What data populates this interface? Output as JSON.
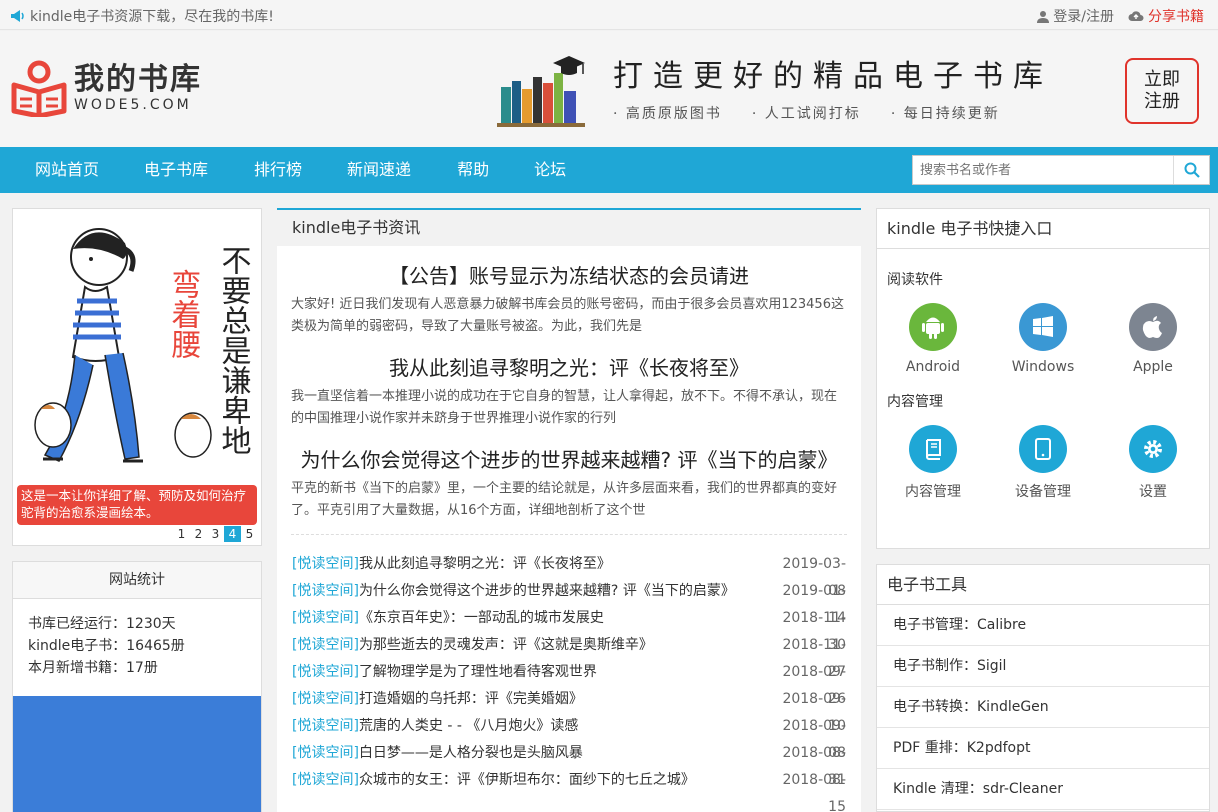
{
  "topbar": {
    "tagline": "kindle电子书资源下载，尽在我的书库!",
    "login": "登录/注册",
    "share": "分享书籍"
  },
  "header": {
    "logo_title": "我的书库",
    "logo_sub": "WODE5.COM",
    "slogan_title": "打造更好的精品电子书库",
    "slogan_items": [
      "· 高质原版图书",
      "· 人工试阅打标",
      "· 每日持续更新"
    ],
    "register_line1": "立即",
    "register_line2": "注册"
  },
  "nav": {
    "items": [
      "网站首页",
      "电子书库",
      "排行榜",
      "新闻速递",
      "帮助",
      "论坛"
    ],
    "search_placeholder": "搜索书名或作者"
  },
  "banner": {
    "title_red": "弯着腰",
    "title_black": "不要总是谦卑地",
    "caption": "这是一本让你详细了解、预防及如何治疗驼背的治愈系漫画绘本。",
    "dots": [
      "1",
      "2",
      "3",
      "4",
      "5"
    ],
    "active_dot": 4
  },
  "stats": {
    "title": "网站统计",
    "lines": [
      "书库已经运行：1230天",
      "kindle电子书：16465册",
      "本月新增书籍：17册"
    ]
  },
  "news": {
    "header": "kindle电子书资讯",
    "articles": [
      {
        "title": "【公告】账号显示为冻结状态的会员请进",
        "summary": "大家好! 近日我们发现有人恶意暴力破解书库会员的账号密码，而由于很多会员喜欢用123456这类极为简单的弱密码，导致了大量账号被盗。为此，我们先是"
      },
      {
        "title": "我从此刻追寻黎明之光：评《长夜将至》",
        "summary": "我一直坚信着一本推理小说的成功在于它自身的智慧，让人拿得起，放不下。不得不承认，现在的中国推理小说作家并未跻身于世界推理小说作家的行列"
      },
      {
        "title": "为什么你会觉得这个进步的世界越来越糟? 评《当下的启蒙》",
        "summary": "平克的新书《当下的启蒙》里，一个主要的结论就是，从许多层面来看，我们的世界都真的变好了。平克引用了大量数据，从16个方面，详细地剖析了这个世"
      }
    ],
    "list": [
      {
        "cat": "[悦读空间]",
        "title": "我从此刻追寻黎明之光：评《长夜将至》",
        "date": "2019-03-08"
      },
      {
        "cat": "[悦读空间]",
        "title": "为什么你会觉得这个进步的世界越来越糟? 评《当下的启蒙》",
        "date": "2019-01-14"
      },
      {
        "cat": "[悦读空间]",
        "title": "《东京百年史》：一部动乱的城市发展史",
        "date": "2018-11-30"
      },
      {
        "cat": "[悦读空间]",
        "title": "为那些逝去的灵魂发声：评《这就是奥斯维辛》",
        "date": "2018-11-27"
      },
      {
        "cat": "[悦读空间]",
        "title": "了解物理学是为了理性地看待客观世界",
        "date": "2018-09-26"
      },
      {
        "cat": "[悦读空间]",
        "title": "打造婚姻的乌托邦：评《完美婚姻》",
        "date": "2018-09-10"
      },
      {
        "cat": "[悦读空间]",
        "title": "荒唐的人类史 - - 《八月炮火》读感",
        "date": "2018-09-08"
      },
      {
        "cat": "[悦读空间]",
        "title": "白日梦——是人格分裂也是头脑风暴",
        "date": "2018-08-31"
      },
      {
        "cat": "[悦读空间]",
        "title": "众城市的女王：评《伊斯坦布尔：面纱下的七丘之城》",
        "date": "2018-08-15"
      }
    ]
  },
  "quick": {
    "title": "kindle 电子书快捷入口",
    "reading_label": "阅读软件",
    "reading": [
      {
        "label": "Android",
        "icon": "android-icon",
        "color": "#6ab73c"
      },
      {
        "label": "Windows",
        "icon": "windows-icon",
        "color": "#3a98d4"
      },
      {
        "label": "Apple",
        "icon": "apple-icon",
        "color": "#7d8591"
      }
    ],
    "manage_label": "内容管理",
    "manage": [
      {
        "label": "内容管理",
        "icon": "book-icon",
        "color": "#1fa7d6"
      },
      {
        "label": "设备管理",
        "icon": "tablet-icon",
        "color": "#1fa7d6"
      },
      {
        "label": "设置",
        "icon": "gear-icon",
        "color": "#1fa7d6"
      }
    ]
  },
  "tools": {
    "title": "电子书工具",
    "items": [
      "电子书管理：Calibre",
      "电子书制作：Sigil",
      "电子书转换：KindleGen",
      "PDF 重排：K2pdfopt",
      "Kindle 清理：sdr-Cleaner"
    ]
  }
}
